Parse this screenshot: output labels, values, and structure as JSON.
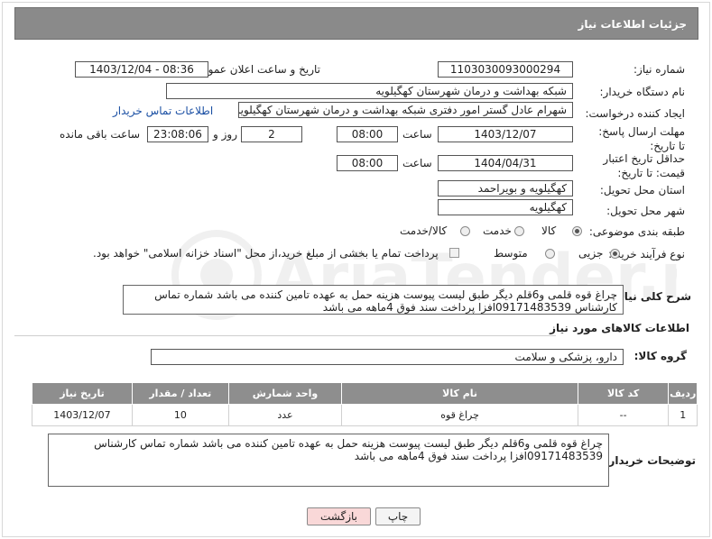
{
  "header": {
    "title": "جزئیات اطلاعات نیاز"
  },
  "form": {
    "need_number_label": "شماره نیاز:",
    "need_number": "1103030093000294",
    "announce_label": "تاریخ و ساعت اعلان عمومی:",
    "announce_value": "1403/12/04 - 08:36",
    "buyer_label": "نام دستگاه خریدار:",
    "buyer_value": "شبکه بهداشت و درمان شهرستان کهگیلویه",
    "creator_label": "ایجاد کننده درخواست:",
    "creator_value": "شهرام عادل گستر امور دفتری شبکه بهداشت و درمان شهرستان کهگیلویه",
    "contact_link": "اطلاعات تماس خریدار",
    "deadline_label": "مهلت ارسال پاسخ: تا تاریخ:",
    "deadline_date": "1403/12/07",
    "time_label": "ساعت",
    "deadline_time": "08:00",
    "days_value": "2",
    "days_label": "روز و",
    "remaining_time": "23:08:06",
    "remaining_label": "ساعت باقی مانده",
    "validity_label": "حداقل تاریخ اعتبار قیمت: تا تاریخ:",
    "validity_date": "1404/04/31",
    "validity_time": "08:00",
    "province_label": "استان محل تحویل:",
    "province_value": "کهگیلویه و بویراحمد",
    "city_label": "شهر محل تحویل:",
    "city_value": "کهگیلویه",
    "category_label": "طبقه بندی موضوعی:",
    "category_options": [
      "کالا",
      "خدمت",
      "کالا/خدمت"
    ],
    "process_label": "نوع فرآیند خرید :",
    "process_options": [
      "جزیی",
      "متوسط"
    ],
    "process_note": "پرداخت تمام یا بخشی از مبلغ خرید،از محل \"اسناد خزانه اسلامی\" خواهد بود."
  },
  "general_desc": {
    "label": "شرح کلی نیاز:",
    "text": "چراغ قوه قلمی و6قلم دیگر طبق لیست پیوست هزینه حمل به عهده تامین کننده می باشد شماره تماس کارشناس 09171483539افزا پرداخت سند فوق 4ماهه می باشد"
  },
  "goods_section": {
    "title": "اطلاعات کالاهای مورد نیاز",
    "group_label": "گروه کالا:",
    "group_value": "دارو، پزشکی و سلامت"
  },
  "table": {
    "headers": [
      "ردیف",
      "کد کالا",
      "نام کالا",
      "واحد شمارش",
      "تعداد / مقدار",
      "تاریخ نیاز"
    ],
    "rows": [
      [
        "1",
        "--",
        "چراغ قوه",
        "عدد",
        "10",
        "1403/12/07"
      ]
    ]
  },
  "buyer_desc": {
    "label": "توضیحات خریدار:",
    "text": "چراغ قوه قلمی و6قلم دیگر طبق لیست پیوست هزینه حمل به عهده تامین کننده می باشد شماره تماس کارشناس 09171483539افزا پرداخت سند فوق 4ماهه می باشد"
  },
  "buttons": {
    "print": "چاپ",
    "back": "بازگشت"
  },
  "watermark": {
    "text": "AriaTender.neT"
  },
  "colors": {
    "header_bg": "#8a8a8a",
    "table_header_bg": "#8e8e8e",
    "link": "#1a4fa3",
    "back_button_bg": "#f9d8d8"
  }
}
